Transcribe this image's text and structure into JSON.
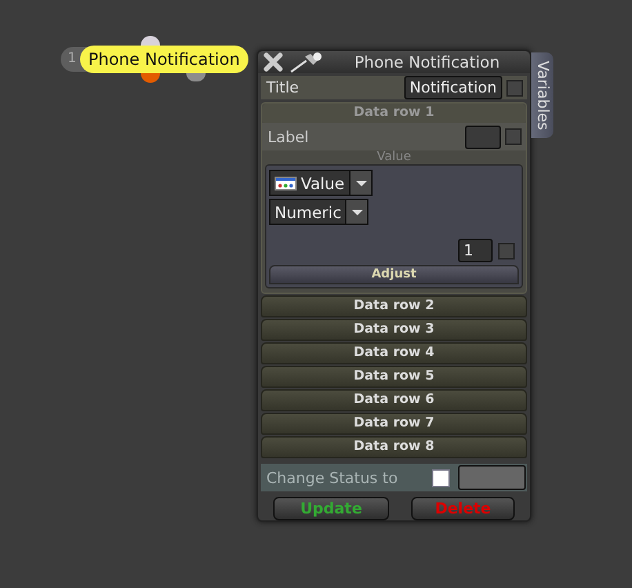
{
  "node": {
    "number": "1",
    "label": "Phone Notification"
  },
  "panel": {
    "title": "Phone Notification",
    "side_tab": "Variables",
    "title_field": {
      "label": "Title",
      "value": "Notification",
      "checked": false
    },
    "data_rows": [
      {
        "label": "Data row 1",
        "expanded": true
      },
      {
        "label": "Data row 2",
        "expanded": false
      },
      {
        "label": "Data row 3",
        "expanded": false
      },
      {
        "label": "Data row 4",
        "expanded": false
      },
      {
        "label": "Data row 5",
        "expanded": false
      },
      {
        "label": "Data row 6",
        "expanded": false
      },
      {
        "label": "Data row 7",
        "expanded": false
      },
      {
        "label": "Data row 8",
        "expanded": false
      }
    ],
    "row_detail": {
      "label": "Label",
      "label_checked": false,
      "value_heading": "Value",
      "value_source": "Value",
      "value_type": "Numeric",
      "number": "1",
      "number_checked": false,
      "adjust": "Adjust"
    },
    "status": {
      "label": "Change Status to",
      "checked": false
    },
    "buttons": [
      {
        "label": "Update",
        "kind": "update"
      },
      {
        "label": "Delete",
        "kind": "delete"
      }
    ]
  }
}
